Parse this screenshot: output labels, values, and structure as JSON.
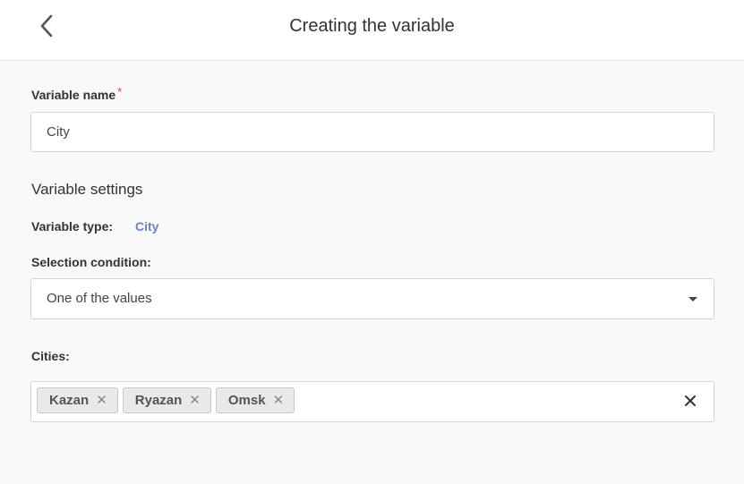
{
  "header": {
    "title": "Creating the variable",
    "back_icon": "chevron-left-icon"
  },
  "variable_name": {
    "label": "Variable name",
    "required_mark": "*",
    "value": "City"
  },
  "settings": {
    "title": "Variable settings",
    "type_label": "Variable type:",
    "type_value": "City",
    "condition_label": "Selection condition:",
    "condition_value": "One of the values"
  },
  "cities": {
    "label": "Cities:",
    "tags": [
      {
        "label": "Kazan",
        "remove": "✕"
      },
      {
        "label": "Ryazan",
        "remove": "✕"
      },
      {
        "label": "Omsk",
        "remove": "✕"
      }
    ]
  },
  "colors": {
    "accent": "#6d84b8",
    "required": "#e0413a",
    "background": "#f9f9f9"
  }
}
